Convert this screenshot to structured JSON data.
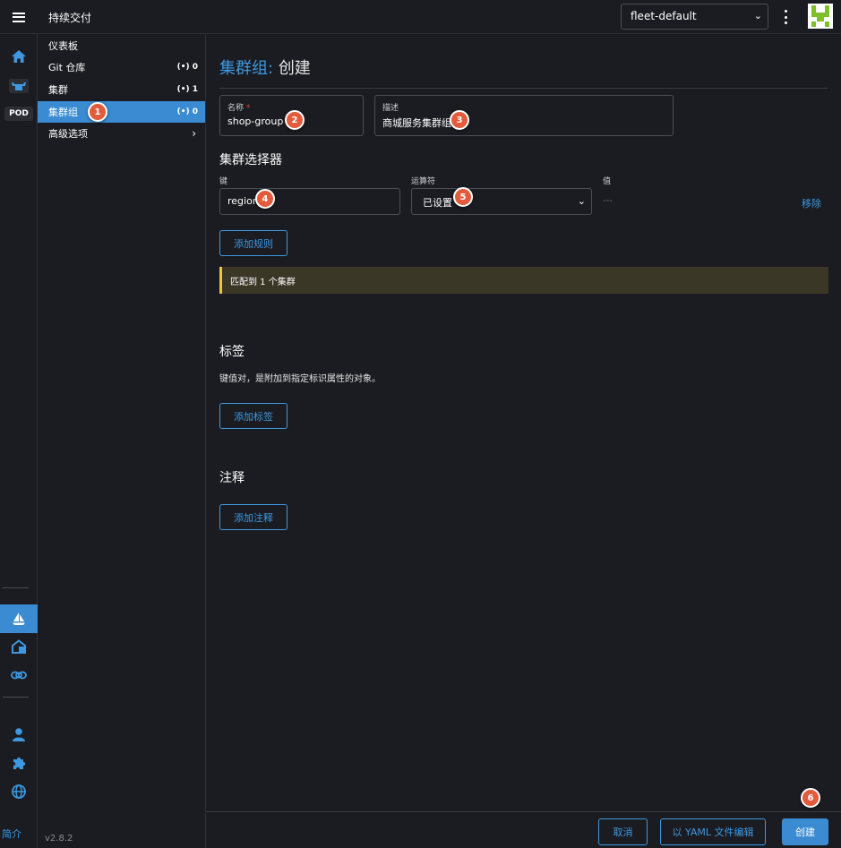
{
  "header": {
    "title": "持续交付",
    "namespace": "fleet-default"
  },
  "rail": {
    "pod_label": "POD",
    "about": "简介"
  },
  "sidenav": {
    "items": [
      {
        "label": "仪表板"
      },
      {
        "label": "Git 仓库",
        "count": "0"
      },
      {
        "label": "集群",
        "count": "1"
      },
      {
        "label": "集群组",
        "count": "0"
      },
      {
        "label": "高级选项"
      }
    ],
    "count_icon": "(•)",
    "version": "v2.8.2"
  },
  "page": {
    "crumb": "集群组:",
    "title": "创建",
    "name_field": {
      "label": "名称",
      "required_mark": "*",
      "value": "shop-group"
    },
    "desc_field": {
      "label": "描述",
      "value": "商城服务集群组"
    },
    "selector": {
      "heading": "集群选择器",
      "key_label": "键",
      "key_value": "region",
      "operator_label": "运算符",
      "operator_value": "已设置",
      "value_label": "值",
      "value_placeholder": "---",
      "remove": "移除",
      "add_rule": "添加规则",
      "match_banner": "匹配到 1 个集群"
    },
    "labels": {
      "heading": "标签",
      "description": "键值对，是附加到指定标识属性的对象。",
      "add": "添加标签"
    },
    "annotations": {
      "heading": "注释",
      "add": "添加注释"
    }
  },
  "footer": {
    "cancel": "取消",
    "edit_yaml": "以 YAML 文件编辑",
    "create": "创建"
  },
  "markers": [
    "1",
    "2",
    "3",
    "4",
    "5",
    "6"
  ],
  "colors": {
    "accent": "#3a8bd1",
    "link": "#3d98e0",
    "banner": "#3b3726",
    "banner_edge": "#e7c93a",
    "marker": "#e25b3c"
  }
}
